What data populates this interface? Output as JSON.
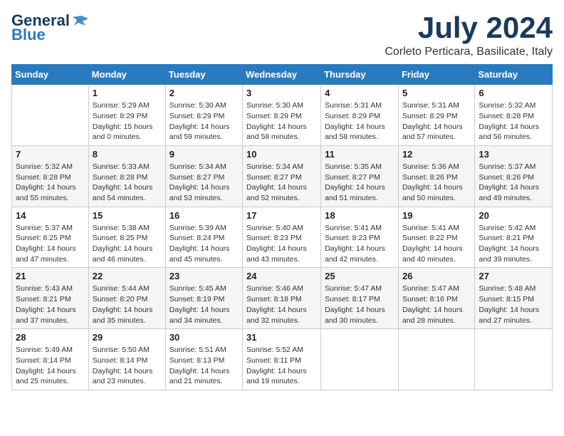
{
  "logo": {
    "general": "General",
    "blue": "Blue"
  },
  "header": {
    "month": "July 2024",
    "location": "Corleto Perticara, Basilicate, Italy"
  },
  "weekdays": [
    "Sunday",
    "Monday",
    "Tuesday",
    "Wednesday",
    "Thursday",
    "Friday",
    "Saturday"
  ],
  "weeks": [
    [
      {
        "day": "",
        "info": ""
      },
      {
        "day": "1",
        "info": "Sunrise: 5:29 AM\nSunset: 8:29 PM\nDaylight: 15 hours\nand 0 minutes."
      },
      {
        "day": "2",
        "info": "Sunrise: 5:30 AM\nSunset: 8:29 PM\nDaylight: 14 hours\nand 59 minutes."
      },
      {
        "day": "3",
        "info": "Sunrise: 5:30 AM\nSunset: 8:29 PM\nDaylight: 14 hours\nand 58 minutes."
      },
      {
        "day": "4",
        "info": "Sunrise: 5:31 AM\nSunset: 8:29 PM\nDaylight: 14 hours\nand 58 minutes."
      },
      {
        "day": "5",
        "info": "Sunrise: 5:31 AM\nSunset: 8:29 PM\nDaylight: 14 hours\nand 57 minutes."
      },
      {
        "day": "6",
        "info": "Sunrise: 5:32 AM\nSunset: 8:28 PM\nDaylight: 14 hours\nand 56 minutes."
      }
    ],
    [
      {
        "day": "7",
        "info": "Sunrise: 5:32 AM\nSunset: 8:28 PM\nDaylight: 14 hours\nand 55 minutes."
      },
      {
        "day": "8",
        "info": "Sunrise: 5:33 AM\nSunset: 8:28 PM\nDaylight: 14 hours\nand 54 minutes."
      },
      {
        "day": "9",
        "info": "Sunrise: 5:34 AM\nSunset: 8:27 PM\nDaylight: 14 hours\nand 53 minutes."
      },
      {
        "day": "10",
        "info": "Sunrise: 5:34 AM\nSunset: 8:27 PM\nDaylight: 14 hours\nand 52 minutes."
      },
      {
        "day": "11",
        "info": "Sunrise: 5:35 AM\nSunset: 8:27 PM\nDaylight: 14 hours\nand 51 minutes."
      },
      {
        "day": "12",
        "info": "Sunrise: 5:36 AM\nSunset: 8:26 PM\nDaylight: 14 hours\nand 50 minutes."
      },
      {
        "day": "13",
        "info": "Sunrise: 5:37 AM\nSunset: 8:26 PM\nDaylight: 14 hours\nand 49 minutes."
      }
    ],
    [
      {
        "day": "14",
        "info": "Sunrise: 5:37 AM\nSunset: 8:25 PM\nDaylight: 14 hours\nand 47 minutes."
      },
      {
        "day": "15",
        "info": "Sunrise: 5:38 AM\nSunset: 8:25 PM\nDaylight: 14 hours\nand 46 minutes."
      },
      {
        "day": "16",
        "info": "Sunrise: 5:39 AM\nSunset: 8:24 PM\nDaylight: 14 hours\nand 45 minutes."
      },
      {
        "day": "17",
        "info": "Sunrise: 5:40 AM\nSunset: 8:23 PM\nDaylight: 14 hours\nand 43 minutes."
      },
      {
        "day": "18",
        "info": "Sunrise: 5:41 AM\nSunset: 8:23 PM\nDaylight: 14 hours\nand 42 minutes."
      },
      {
        "day": "19",
        "info": "Sunrise: 5:41 AM\nSunset: 8:22 PM\nDaylight: 14 hours\nand 40 minutes."
      },
      {
        "day": "20",
        "info": "Sunrise: 5:42 AM\nSunset: 8:21 PM\nDaylight: 14 hours\nand 39 minutes."
      }
    ],
    [
      {
        "day": "21",
        "info": "Sunrise: 5:43 AM\nSunset: 8:21 PM\nDaylight: 14 hours\nand 37 minutes."
      },
      {
        "day": "22",
        "info": "Sunrise: 5:44 AM\nSunset: 8:20 PM\nDaylight: 14 hours\nand 35 minutes."
      },
      {
        "day": "23",
        "info": "Sunrise: 5:45 AM\nSunset: 8:19 PM\nDaylight: 14 hours\nand 34 minutes."
      },
      {
        "day": "24",
        "info": "Sunrise: 5:46 AM\nSunset: 8:18 PM\nDaylight: 14 hours\nand 32 minutes."
      },
      {
        "day": "25",
        "info": "Sunrise: 5:47 AM\nSunset: 8:17 PM\nDaylight: 14 hours\nand 30 minutes."
      },
      {
        "day": "26",
        "info": "Sunrise: 5:47 AM\nSunset: 8:16 PM\nDaylight: 14 hours\nand 28 minutes."
      },
      {
        "day": "27",
        "info": "Sunrise: 5:48 AM\nSunset: 8:15 PM\nDaylight: 14 hours\nand 27 minutes."
      }
    ],
    [
      {
        "day": "28",
        "info": "Sunrise: 5:49 AM\nSunset: 8:14 PM\nDaylight: 14 hours\nand 25 minutes."
      },
      {
        "day": "29",
        "info": "Sunrise: 5:50 AM\nSunset: 8:14 PM\nDaylight: 14 hours\nand 23 minutes."
      },
      {
        "day": "30",
        "info": "Sunrise: 5:51 AM\nSunset: 8:13 PM\nDaylight: 14 hours\nand 21 minutes."
      },
      {
        "day": "31",
        "info": "Sunrise: 5:52 AM\nSunset: 8:11 PM\nDaylight: 14 hours\nand 19 minutes."
      },
      {
        "day": "",
        "info": ""
      },
      {
        "day": "",
        "info": ""
      },
      {
        "day": "",
        "info": ""
      }
    ]
  ]
}
